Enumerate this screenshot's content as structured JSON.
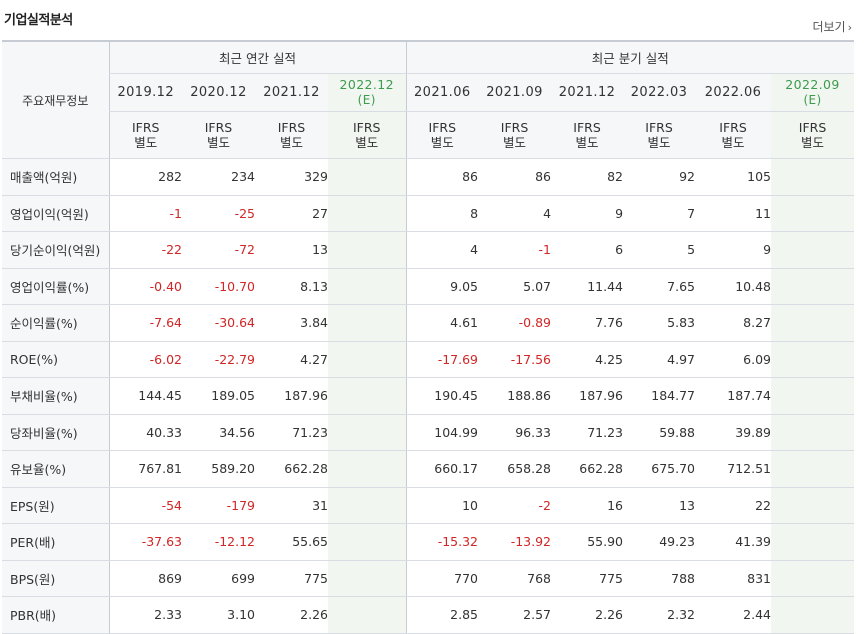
{
  "header": {
    "title": "기업실적분석",
    "more_label": "더보기"
  },
  "table": {
    "corner_label": "주요재무정보",
    "groups": {
      "annual": "최근 연간 실적",
      "quarterly": "최근 분기 실적"
    },
    "periods": [
      "2019.12",
      "2020.12",
      "2021.12",
      "2022.12",
      "2021.06",
      "2021.09",
      "2021.12",
      "2022.03",
      "2022.06",
      "2022.09"
    ],
    "estimate_label": "(E)",
    "ifrs_line1": "IFRS",
    "ifrs_line2": "별도",
    "rows": [
      {
        "label": "매출액(억원)",
        "values": [
          "282",
          "234",
          "329",
          "",
          "86",
          "86",
          "82",
          "92",
          "105",
          ""
        ]
      },
      {
        "label": "영업이익(억원)",
        "values": [
          "-1",
          "-25",
          "27",
          "",
          "8",
          "4",
          "9",
          "7",
          "11",
          ""
        ]
      },
      {
        "label": "당기순이익(억원)",
        "values": [
          "-22",
          "-72",
          "13",
          "",
          "4",
          "-1",
          "6",
          "5",
          "9",
          ""
        ]
      },
      {
        "label": "영업이익률(%)",
        "values": [
          "-0.40",
          "-10.70",
          "8.13",
          "",
          "9.05",
          "5.07",
          "11.44",
          "7.65",
          "10.48",
          ""
        ]
      },
      {
        "label": "순이익률(%)",
        "values": [
          "-7.64",
          "-30.64",
          "3.84",
          "",
          "4.61",
          "-0.89",
          "7.76",
          "5.83",
          "8.27",
          ""
        ]
      },
      {
        "label": "ROE(%)",
        "values": [
          "-6.02",
          "-22.79",
          "4.27",
          "",
          "-17.69",
          "-17.56",
          "4.25",
          "4.97",
          "6.09",
          ""
        ]
      },
      {
        "label": "부채비율(%)",
        "values": [
          "144.45",
          "189.05",
          "187.96",
          "",
          "190.45",
          "188.86",
          "187.96",
          "184.77",
          "187.74",
          ""
        ]
      },
      {
        "label": "당좌비율(%)",
        "values": [
          "40.33",
          "34.56",
          "71.23",
          "",
          "104.99",
          "96.33",
          "71.23",
          "59.88",
          "39.89",
          ""
        ]
      },
      {
        "label": "유보율(%)",
        "values": [
          "767.81",
          "589.20",
          "662.28",
          "",
          "660.17",
          "658.28",
          "662.28",
          "675.70",
          "712.51",
          ""
        ]
      },
      {
        "label": "EPS(원)",
        "values": [
          "-54",
          "-179",
          "31",
          "",
          "10",
          "-2",
          "16",
          "13",
          "22",
          ""
        ]
      },
      {
        "label": "PER(배)",
        "values": [
          "-37.63",
          "-12.12",
          "55.65",
          "",
          "-15.32",
          "-13.92",
          "55.90",
          "49.23",
          "41.39",
          ""
        ]
      },
      {
        "label": "BPS(원)",
        "values": [
          "869",
          "699",
          "775",
          "",
          "770",
          "768",
          "775",
          "788",
          "831",
          ""
        ]
      },
      {
        "label": "PBR(배)",
        "values": [
          "2.33",
          "3.10",
          "2.26",
          "",
          "2.85",
          "2.57",
          "2.26",
          "2.32",
          "2.44",
          ""
        ]
      }
    ],
    "colors": {
      "negative": "#d02626",
      "ifrs": "#f06a1d",
      "estimate": "#3d9a4e",
      "estimate_bg": "#f1f7f0"
    }
  }
}
